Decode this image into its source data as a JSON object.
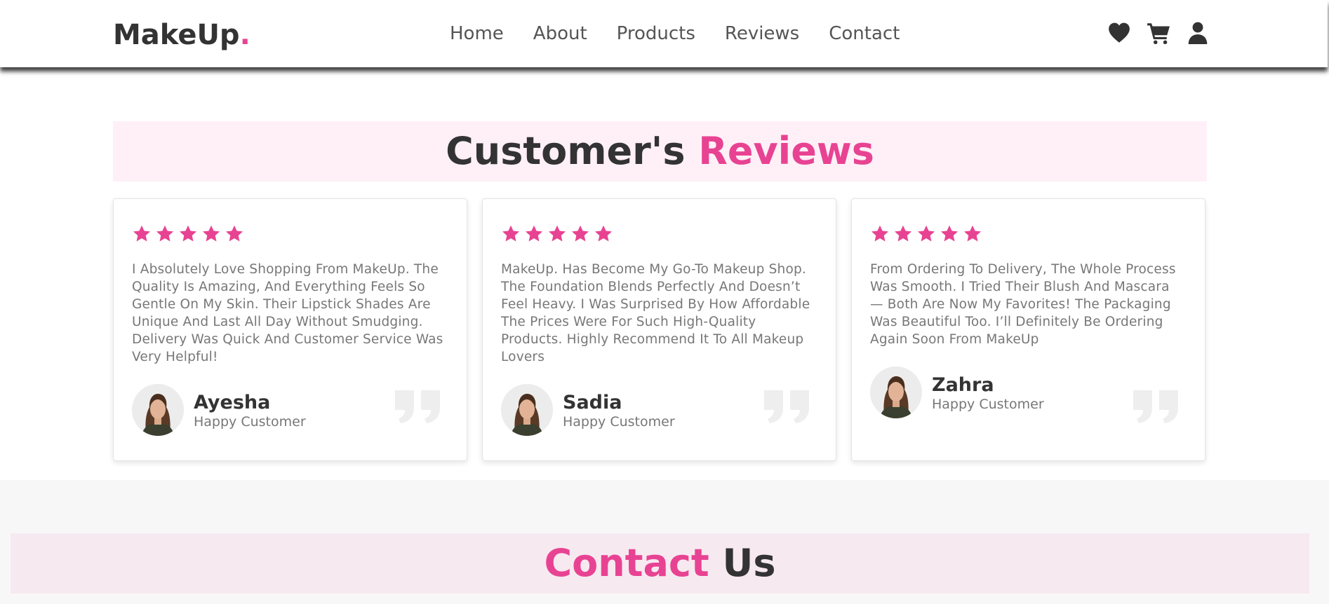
{
  "header": {
    "logo_text": "MakeUp",
    "logo_dot": ".",
    "nav": [
      {
        "label": "Home"
      },
      {
        "label": "About"
      },
      {
        "label": "Products"
      },
      {
        "label": "Reviews"
      },
      {
        "label": "Contact"
      }
    ],
    "icons": [
      "heart-icon",
      "cart-icon",
      "user-icon"
    ]
  },
  "reviews_section": {
    "title_plain": "Customer's",
    "title_accent": "Reviews",
    "reviews": [
      {
        "rating": 5,
        "text": "I Absolutely Love Shopping From MakeUp. The Quality Is Amazing, And Everything Feels So Gentle On My Skin. Their Lipstick Shades Are Unique And Last All Day Without Smudging. Delivery Was Quick And Customer Service Was Very Helpful!",
        "name": "Ayesha",
        "role": "Happy Customer"
      },
      {
        "rating": 5,
        "text": "MakeUp. Has Become My Go-To Makeup Shop. The Foundation Blends Perfectly And Doesn’t Feel Heavy. I Was Surprised By How Affordable The Prices Were For Such High-Quality Products. Highly Recommend It To All Makeup Lovers",
        "name": "Sadia",
        "role": "Happy Customer"
      },
      {
        "rating": 5,
        "text": "From Ordering To Delivery, The Whole Process Was Smooth. I Tried Their Blush And Mascara — Both Are Now My Favorites! The Packaging Was Beautiful Too. I’ll Definitely Be Ordering Again Soon From MakeUp",
        "name": "Zahra",
        "role": "Happy Customer"
      }
    ]
  },
  "contact_section": {
    "title_accent": "Contact",
    "title_plain": "Us"
  },
  "colors": {
    "accent": "#e84393",
    "text_dark": "#333333",
    "text_muted": "#777777",
    "title_band": "#fff0f7",
    "contact_band": "#f7e9f0"
  }
}
